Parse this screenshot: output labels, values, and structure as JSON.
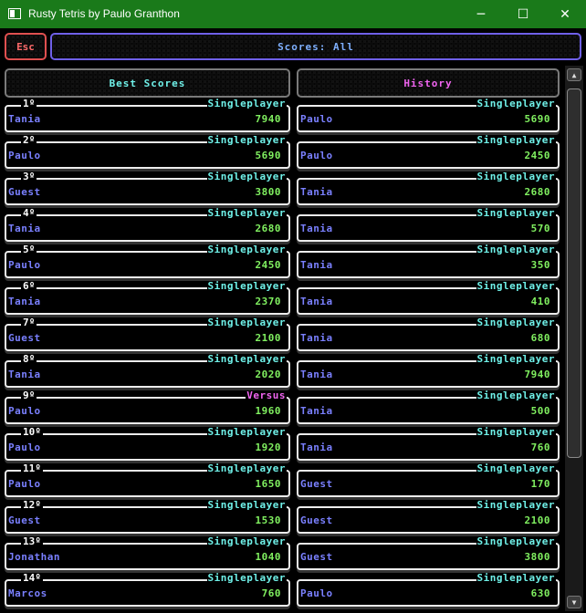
{
  "window": {
    "title": "Rusty Tetris by Paulo Granthon",
    "minimize": "─",
    "maximize": "☐",
    "close": "✕"
  },
  "top": {
    "esc_label": "Esc",
    "scores_label": "Scores: All"
  },
  "best": {
    "header": "Best Scores",
    "entries": [
      {
        "rank": "1º",
        "mode": "Singleplayer",
        "name": "Tania",
        "score": "7940"
      },
      {
        "rank": "2º",
        "mode": "Singleplayer",
        "name": "Paulo",
        "score": "5690"
      },
      {
        "rank": "3º",
        "mode": "Singleplayer",
        "name": "Guest",
        "score": "3800"
      },
      {
        "rank": "4º",
        "mode": "Singleplayer",
        "name": "Tania",
        "score": "2680"
      },
      {
        "rank": "5º",
        "mode": "Singleplayer",
        "name": "Paulo",
        "score": "2450"
      },
      {
        "rank": "6º",
        "mode": "Singleplayer",
        "name": "Tania",
        "score": "2370"
      },
      {
        "rank": "7º",
        "mode": "Singleplayer",
        "name": "Guest",
        "score": "2100"
      },
      {
        "rank": "8º",
        "mode": "Singleplayer",
        "name": "Tania",
        "score": "2020"
      },
      {
        "rank": "9º",
        "mode": "Versus",
        "name": "Paulo",
        "score": "1960"
      },
      {
        "rank": "10º",
        "mode": "Singleplayer",
        "name": "Paulo",
        "score": "1920"
      },
      {
        "rank": "11º",
        "mode": "Singleplayer",
        "name": "Paulo",
        "score": "1650"
      },
      {
        "rank": "12º",
        "mode": "Singleplayer",
        "name": "Guest",
        "score": "1530"
      },
      {
        "rank": "13º",
        "mode": "Singleplayer",
        "name": "Jonathan",
        "score": "1040"
      },
      {
        "rank": "14º",
        "mode": "Singleplayer",
        "name": "Marcos",
        "score": "760"
      }
    ]
  },
  "history": {
    "header": "History",
    "entries": [
      {
        "mode": "Singleplayer",
        "name": "Paulo",
        "score": "5690"
      },
      {
        "mode": "Singleplayer",
        "name": "Paulo",
        "score": "2450"
      },
      {
        "mode": "Singleplayer",
        "name": "Tania",
        "score": "2680"
      },
      {
        "mode": "Singleplayer",
        "name": "Tania",
        "score": "570"
      },
      {
        "mode": "Singleplayer",
        "name": "Tania",
        "score": "350"
      },
      {
        "mode": "Singleplayer",
        "name": "Tania",
        "score": "410"
      },
      {
        "mode": "Singleplayer",
        "name": "Tania",
        "score": "680"
      },
      {
        "mode": "Singleplayer",
        "name": "Tania",
        "score": "7940"
      },
      {
        "mode": "Singleplayer",
        "name": "Tania",
        "score": "500"
      },
      {
        "mode": "Singleplayer",
        "name": "Tania",
        "score": "760"
      },
      {
        "mode": "Singleplayer",
        "name": "Guest",
        "score": "170"
      },
      {
        "mode": "Singleplayer",
        "name": "Guest",
        "score": "2100"
      },
      {
        "mode": "Singleplayer",
        "name": "Guest",
        "score": "3800"
      },
      {
        "mode": "Singleplayer",
        "name": "Paulo",
        "score": "630"
      }
    ]
  },
  "scrollbar": {
    "up_icon": "▲",
    "down_icon": "▼"
  },
  "colors": {
    "titlebar": "#1a7a1a",
    "singleplayer": "#6ff0e8",
    "versus": "#f064f0",
    "name": "#7a80ff",
    "score": "#80f060",
    "esc": "#e05050",
    "scores_border": "#6f60e8"
  }
}
